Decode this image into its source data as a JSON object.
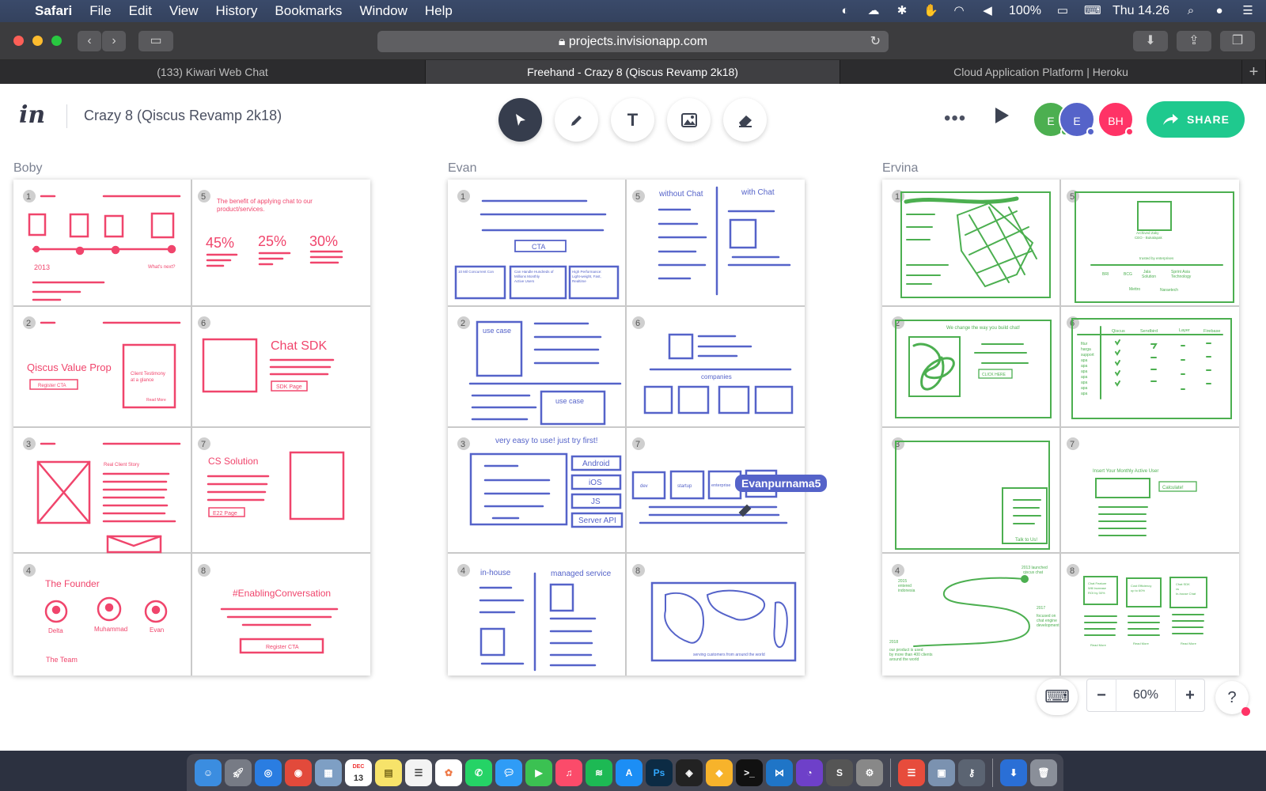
{
  "menubar": {
    "app": "Safari",
    "items": [
      "File",
      "Edit",
      "View",
      "History",
      "Bookmarks",
      "Window",
      "Help"
    ],
    "battery": "100%",
    "clock": "Thu 14.26"
  },
  "browser": {
    "url": "projects.invisionapp.com",
    "tabs": [
      {
        "label": "(133) Kiwari Web Chat"
      },
      {
        "label": "Freehand - Crazy 8 (Qiscus Revamp 2k18)"
      },
      {
        "label": "Cloud Application Platform | Heroku"
      }
    ],
    "new_tab": "+"
  },
  "app": {
    "logo": "in",
    "project_title": "Crazy 8 (Qiscus Revamp 2k18)",
    "tools": [
      "select-tool",
      "pen-tool",
      "text-tool",
      "image-tool",
      "eraser-tool"
    ],
    "text_tool_glyph": "T",
    "more": "•••",
    "avatars": [
      {
        "initials": "E",
        "color": "#4caf50",
        "status": "#4caf50"
      },
      {
        "initials": "E",
        "color": "#5563c9",
        "status": "#5563c9"
      },
      {
        "initials": "BH",
        "color": "#ff3366",
        "status": "#ff3366"
      }
    ],
    "share_label": "SHARE",
    "accent": "#1fc98e"
  },
  "boards": [
    {
      "name": "Boby",
      "color": "#f0456c"
    },
    {
      "name": "Evan",
      "color": "#5563c9"
    },
    {
      "name": "Ervina",
      "color": "#4caf50"
    }
  ],
  "sketch_text": {
    "boby": {
      "c5_heading": "The benefit of applying chat to our",
      "c5_heading2": "product/services.",
      "stat1": "45%",
      "stat2": "25%",
      "stat3": "30%",
      "year": "2013",
      "whats_next": "What's next?",
      "value_prop": "Qiscus Value Prop",
      "register_cta": "Register CTA",
      "testimony1": "Client Testimony",
      "testimony2": "at a glance",
      "read_more": "Read More",
      "chat_sdk": "Chat SDK",
      "sdk_page": "SDK Page",
      "real_client": "Real Client Story",
      "cs_solution": "CS Solution",
      "e22_page": "E22 Page",
      "founder": "The Founder",
      "p1": "Delta",
      "p2": "Muhammad",
      "p3": "Evan",
      "team": "The Team",
      "hashtag": "#EnablingConversation",
      "register_cta2": "Register CTA"
    },
    "evan": {
      "cta": "CTA",
      "f1": "10 Mil Concurrent Con",
      "f2a": "Can Handle Hundreds of",
      "f2b": "Millions Monthly",
      "f2c": "Active Users",
      "f3a": "High Performance:",
      "f3b": "Light-weight, Fast,",
      "f3c": "Realtime",
      "without_chat": "without Chat",
      "with_chat": "with Chat",
      "use_case": "use case",
      "use_case2": "use case",
      "companies": "companies",
      "easy": "very easy to use! just try first!",
      "android": "Android",
      "ios": "iOS",
      "js": "JS",
      "server_api": "Server API",
      "dev": "dev",
      "startup": "startup",
      "enterprise": "enterprise",
      "ent_short": "E",
      "in_house": "in-house",
      "managed": "managed service",
      "serving": "serving customers from around the world"
    },
    "ervina": {
      "person_name": "Archived Zaky",
      "person_title": "CEO - Bukalapak",
      "trusted": "trusted by enterprises",
      "logo1": "BRI",
      "logo2": "BCG",
      "logo3a": "Jala",
      "logo3b": "Solution",
      "logo4a": "Sprint Asia",
      "logo4b": "Technology",
      "logo5": "Mettro",
      "logo6": "Naraetech",
      "change": "We change the way you build chat!",
      "click_here": "CLICK HERE",
      "cols": [
        "Qiscus",
        "Sendbird",
        "Layer",
        "Firebase"
      ],
      "rows": [
        "fitur",
        "harga",
        "support",
        "apa",
        "apa",
        "apa",
        "apa",
        "apa",
        "apa",
        "apa"
      ],
      "talk": "Talk to Us!",
      "insert_mau": "Insert Your Monthly Active User",
      "calculate": "Calculate!",
      "t2013a": "2013 launched",
      "t2013b": "qiscus chat",
      "t2015a": "2015",
      "t2015b": "entered",
      "t2015c": "indonesia",
      "t2017a": "2017",
      "t2017b": "focused on",
      "t2017c": "chat engine",
      "t2017d": "development",
      "t2018": "2018",
      "t2018b": "our product is used",
      "t2018c": "by more than 400 clients",
      "t2018d": "around the world",
      "b1a": "Chat Feature",
      "b1b": "Will Increase",
      "b1c": "ROI by 30%",
      "b2a": "Cost Efficiency",
      "b2b": "up to 60%",
      "b3a": "Chat SDK",
      "b3b": "vs",
      "b3c": "In-house Chat",
      "read_more": "Read More"
    }
  },
  "cursor": {
    "user": "Evanpurnama5"
  },
  "zoom": {
    "minus": "−",
    "value": "60%",
    "plus": "+"
  },
  "help": "?",
  "keyboard_icon": "keyboard-icon",
  "dock": {
    "calendar_month": "DEC",
    "calendar_day": "13",
    "badge_whatsapp": "90",
    "badge_calendar": "1"
  }
}
